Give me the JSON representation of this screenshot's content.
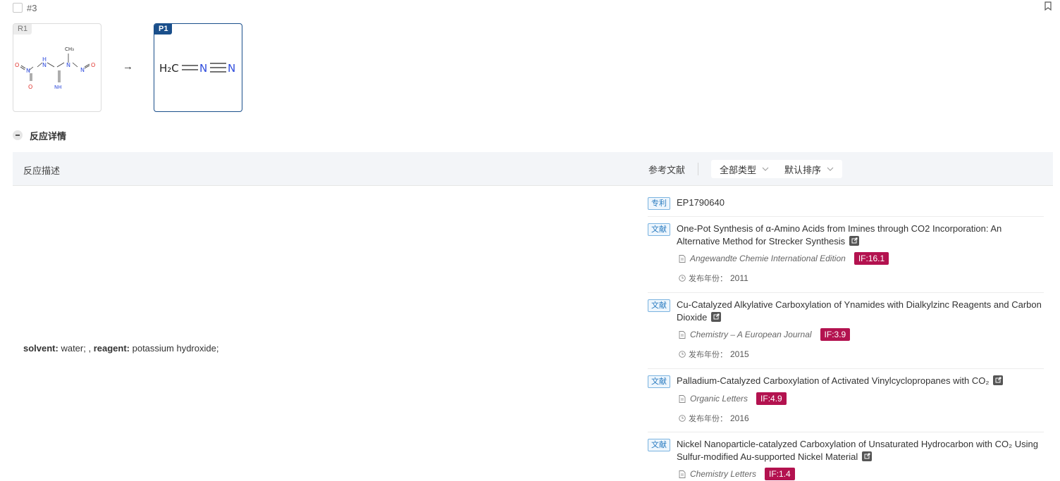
{
  "reaction": {
    "number": "#3",
    "reactant_tag": "R1",
    "product_tag": "P1",
    "arrow": "→"
  },
  "reactant_structure": {
    "labels": [
      "O",
      "N",
      "O",
      "H",
      "N",
      "N",
      "H",
      "NH",
      "CH₃",
      "N",
      "N",
      "O"
    ]
  },
  "product_structure": {
    "h2c": "H₂C",
    "n1": "N",
    "n2": "N"
  },
  "section": {
    "title": "反应详情"
  },
  "table": {
    "desc_header": "反应描述",
    "ref_header": "参考文献",
    "type_filter": "全部类型",
    "sort_filter": "默认排序"
  },
  "description": {
    "solvent_label": "solvent:",
    "solvent_value": " water; , ",
    "reagent_label": "reagent:",
    "reagent_value": " potassium hydroxide;"
  },
  "references": [
    {
      "tag": "专利",
      "title": "EP1790640"
    },
    {
      "tag": "文献",
      "title": "One-Pot Synthesis of α-Amino Acids from Imines through CO2 Incorporation: An Alternative Method for Strecker Synthesis",
      "journal": "Angewandte Chemie International Edition",
      "impact": "IF:16.1",
      "year_label": "发布年份：",
      "year": "2011"
    },
    {
      "tag": "文献",
      "title": "Cu-Catalyzed Alkylative Carboxylation of Ynamides with Dialkylzinc Reagents and Carbon Dioxide",
      "journal": "Chemistry – A European Journal",
      "impact": "IF:3.9",
      "year_label": "发布年份：",
      "year": "2015"
    },
    {
      "tag": "文献",
      "title": "Palladium-Catalyzed Carboxylation of Activated Vinylcyclopropanes with CO₂",
      "journal": "Organic Letters",
      "impact": "IF:4.9",
      "year_label": "发布年份：",
      "year": "2016"
    },
    {
      "tag": "文献",
      "title": "Nickel Nanoparticle-catalyzed Carboxylation of Unsaturated Hydrocarbon with CO₂ Using Sulfur-modified Au-supported Nickel Material",
      "journal": "Chemistry Letters",
      "impact": "IF:1.4"
    }
  ],
  "colors": {
    "accent": "#1a4f8b",
    "impact_badge": "#b3124f",
    "tag_border": "#7ab3e0",
    "oxygen": "#e0312b",
    "nitrogen": "#2f4cdd"
  }
}
